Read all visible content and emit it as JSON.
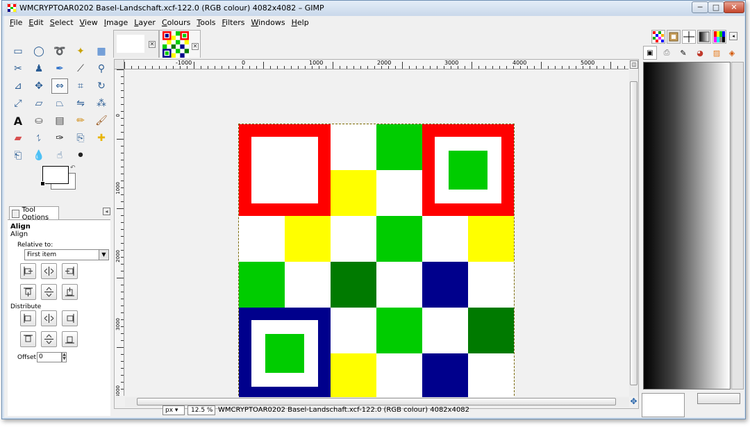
{
  "window": {
    "title": "WMCRYPTOAR0202 Basel-Landschaft.xcf-122.0 (RGB colour) 4082x4082 – GIMP",
    "minimize": "─",
    "maximize": "□",
    "close": "✕"
  },
  "menubar": [
    "File",
    "Edit",
    "Select",
    "View",
    "Image",
    "Layer",
    "Colours",
    "Tools",
    "Filters",
    "Windows",
    "Help"
  ],
  "toolbox": {
    "tools": [
      "rect-select-icon",
      "ellipse-select-icon",
      "free-select-icon",
      "fuzzy-select-icon",
      "color-select-icon",
      "scissors-icon",
      "foreground-select-icon",
      "paths-icon",
      "color-picker-icon",
      "zoom-icon",
      "measure-icon",
      "move-icon",
      "align-icon",
      "crop-icon",
      "rotate-icon",
      "scale-icon",
      "shear-icon",
      "perspective-icon",
      "flip-icon",
      "cage-icon",
      "text-icon",
      "bucket-fill-icon",
      "blend-icon",
      "pencil-icon",
      "paintbrush-icon",
      "eraser-icon",
      "airbrush-icon",
      "ink-icon",
      "clone-icon",
      "heal-icon",
      "perspective-clone-icon",
      "blur-icon",
      "smudge-icon",
      "dodge-burn-icon"
    ],
    "active_tool": "align-icon"
  },
  "tool_options": {
    "tab_label": "Tool Options",
    "title": "Align",
    "subtitle": "Align",
    "relative_label": "Relative to:",
    "relative_value": "First item",
    "distribute_label": "Distribute",
    "offset_label": "Offset:",
    "offset_value": "0"
  },
  "rulers": {
    "h_labels": [
      "-1000",
      "0",
      "1000",
      "2000",
      "3000",
      "4000",
      "5000"
    ],
    "v_labels": [
      "0",
      "1000",
      "2000",
      "3000",
      "4000"
    ]
  },
  "statusbar": {
    "unit": "px",
    "zoom": "12.5 %",
    "text": "WMCRYPTOAR0202 Basel-Landschaft.xcf-122.0 (RGB colour) 4082x4082"
  },
  "image": {
    "grid": [
      [
        "frame-red-blue",
        "frame-red-blue",
        "white",
        "green",
        "frame-red-green",
        "frame-red-green"
      ],
      [
        "frame-red-blue",
        "frame-red-blue",
        "yellow",
        "white",
        "frame-red-green",
        "frame-red-green"
      ],
      [
        "white",
        "yellow",
        "white",
        "green",
        "white",
        "yellow"
      ],
      [
        "green",
        "white",
        "darkgreen",
        "white",
        "navy",
        "white"
      ],
      [
        "frame-navy-green",
        "frame-navy-green",
        "white",
        "green",
        "white",
        "darkgreen"
      ],
      [
        "frame-navy-green",
        "frame-navy-green",
        "yellow",
        "white",
        "navy",
        "white"
      ]
    ],
    "colors": {
      "red": "#ff0000",
      "navy": "#00008c",
      "green": "#00cc00",
      "darkgreen": "#007a00",
      "yellow": "#ffff00",
      "white": "#ffffff"
    }
  }
}
